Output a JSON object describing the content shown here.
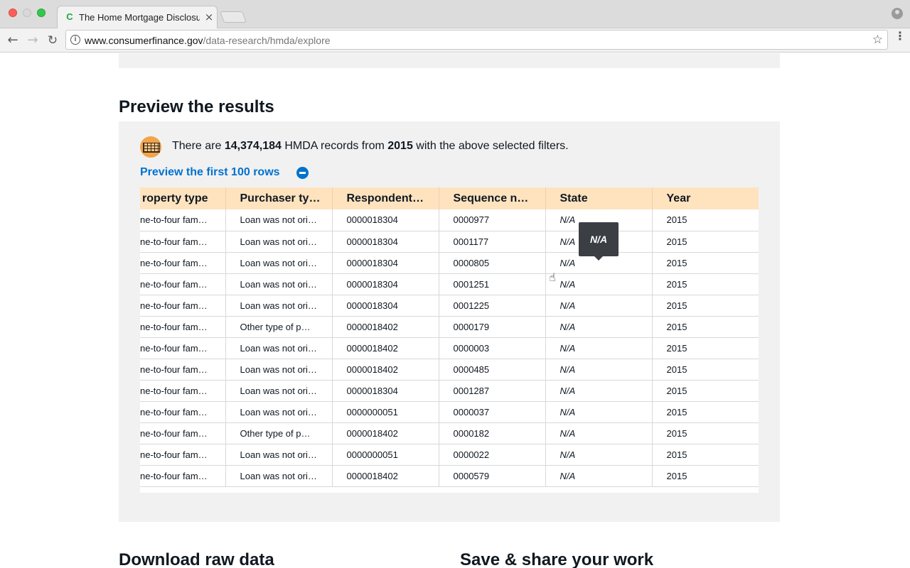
{
  "browser": {
    "tab_title": "The Home Mortgage Disclosur",
    "tab_favicon": "C",
    "tab_close": "×",
    "url_host": "www.consumerfinance.gov",
    "url_path": "/data-research/hmda/explore",
    "info_glyph": "i",
    "star_glyph": "☆",
    "back_glyph": "←",
    "forward_glyph": "→",
    "reload_glyph": "↻",
    "menu_glyph": "⋮"
  },
  "page": {
    "section_title": "Preview the results",
    "summary": {
      "prefix": "There are ",
      "record_count": "14,374,184",
      "middle": " HMDA records from ",
      "year": "2015",
      "suffix": " with the above selected filters."
    },
    "preview_link": "Preview the first 100 rows",
    "tooltip": "N/A",
    "bottom_left_title": "Download raw data",
    "bottom_right_title": "Save & share your work"
  },
  "table": {
    "headers": [
      "roperty type",
      "Purchaser ty…",
      "Respondent…",
      "Sequence n…",
      "State",
      "Year"
    ],
    "rows": [
      [
        "ne-to-four fam…",
        "Loan was not ori…",
        "0000018304",
        "0000977",
        "N/A",
        "2015"
      ],
      [
        "ne-to-four fam…",
        "Loan was not ori…",
        "0000018304",
        "0001177",
        "N/A",
        "2015"
      ],
      [
        "ne-to-four fam…",
        "Loan was not ori…",
        "0000018304",
        "0000805",
        "N/A",
        "2015"
      ],
      [
        "ne-to-four fam…",
        "Loan was not ori…",
        "0000018304",
        "0001251",
        "N/A",
        "2015"
      ],
      [
        "ne-to-four fam…",
        "Loan was not ori…",
        "0000018304",
        "0001225",
        "N/A",
        "2015"
      ],
      [
        "ne-to-four fam…",
        "Other type of p…",
        "0000018402",
        "0000179",
        "N/A",
        "2015"
      ],
      [
        "ne-to-four fam…",
        "Loan was not ori…",
        "0000018402",
        "0000003",
        "N/A",
        "2015"
      ],
      [
        "ne-to-four fam…",
        "Loan was not ori…",
        "0000018402",
        "0000485",
        "N/A",
        "2015"
      ],
      [
        "ne-to-four fam…",
        "Loan was not ori…",
        "0000018304",
        "0001287",
        "N/A",
        "2015"
      ],
      [
        "ne-to-four fam…",
        "Loan was not ori…",
        "0000000051",
        "0000037",
        "N/A",
        "2015"
      ],
      [
        "ne-to-four fam…",
        "Other type of p…",
        "0000018402",
        "0000182",
        "N/A",
        "2015"
      ],
      [
        "ne-to-four fam…",
        "Loan was not ori…",
        "0000000051",
        "0000022",
        "N/A",
        "2015"
      ],
      [
        "ne-to-four fam…",
        "Loan was not ori…",
        "0000018402",
        "0000579",
        "N/A",
        "2015"
      ]
    ]
  },
  "colors": {
    "accent_blue": "#0072ce",
    "header_orange": "#ffe3bf",
    "panel_gray": "#f1f1f1",
    "icon_orange": "#f2a44a"
  }
}
